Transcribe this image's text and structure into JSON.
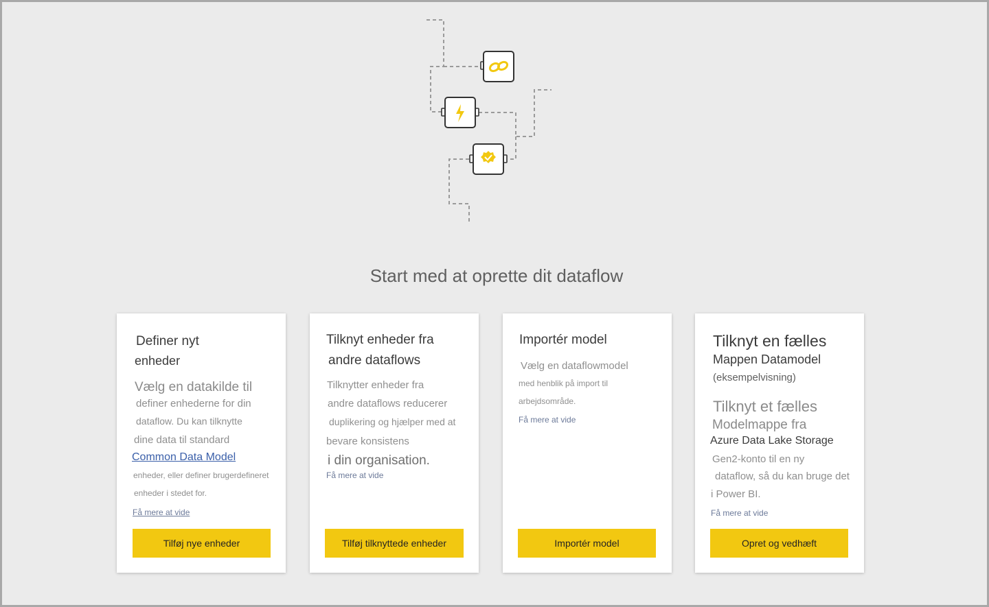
{
  "page": {
    "title": "Start med at oprette dit dataflow"
  },
  "illustration": {
    "icons": [
      "link-icon",
      "lightning-icon",
      "check-badge-icon"
    ],
    "accent_color": "#f2c811"
  },
  "colors": {
    "background": "#ebebeb",
    "card": "#ffffff",
    "button": "#f2c811",
    "link": "#3a5fa9"
  },
  "cards": [
    {
      "title_lines": [
        "Definer nyt",
        "enheder"
      ],
      "body_lines": [
        "Vælg en datakilde til",
        "definer enhederne for din",
        "dataflow. Du kan tilknytte",
        "dine data til standard",
        "Common Data Model",
        "enheder,  eller definer  brugerdefineret",
        "enheder i stedet for."
      ],
      "learn_more": "Få mere at vide",
      "button": "Tilføj nye enheder"
    },
    {
      "title_lines": [
        "Tilknyt enheder fra",
        "andre dataflows"
      ],
      "body_lines": [
        "Tilknytter enheder fra",
        "andre dataflows reducerer",
        "duplikering og hjælper med at",
        "bevare konsistens",
        "i din organisation."
      ],
      "learn_more": "Få mere at vide",
      "button": "Tilføj tilknyttede enheder"
    },
    {
      "title_lines": [
        "Importér model"
      ],
      "body_lines": [
        "Vælg en dataflowmodel",
        "med henblik på import til",
        "arbejdsområde."
      ],
      "learn_more": "Få mere at vide",
      "button": "Importér model"
    },
    {
      "title_lines": [
        "Tilknyt en fælles",
        "Mappen Datamodel",
        "(eksempelvisning)"
      ],
      "body_lines": [
        "Tilknyt et fælles",
        "Modelmappe fra",
        "Azure Data Lake Storage",
        "Gen2-konto til en ny",
        "dataflow, så du kan bruge det",
        "i Power BI."
      ],
      "learn_more": "Få mere at vide",
      "button": "Opret og vedhæft"
    }
  ]
}
